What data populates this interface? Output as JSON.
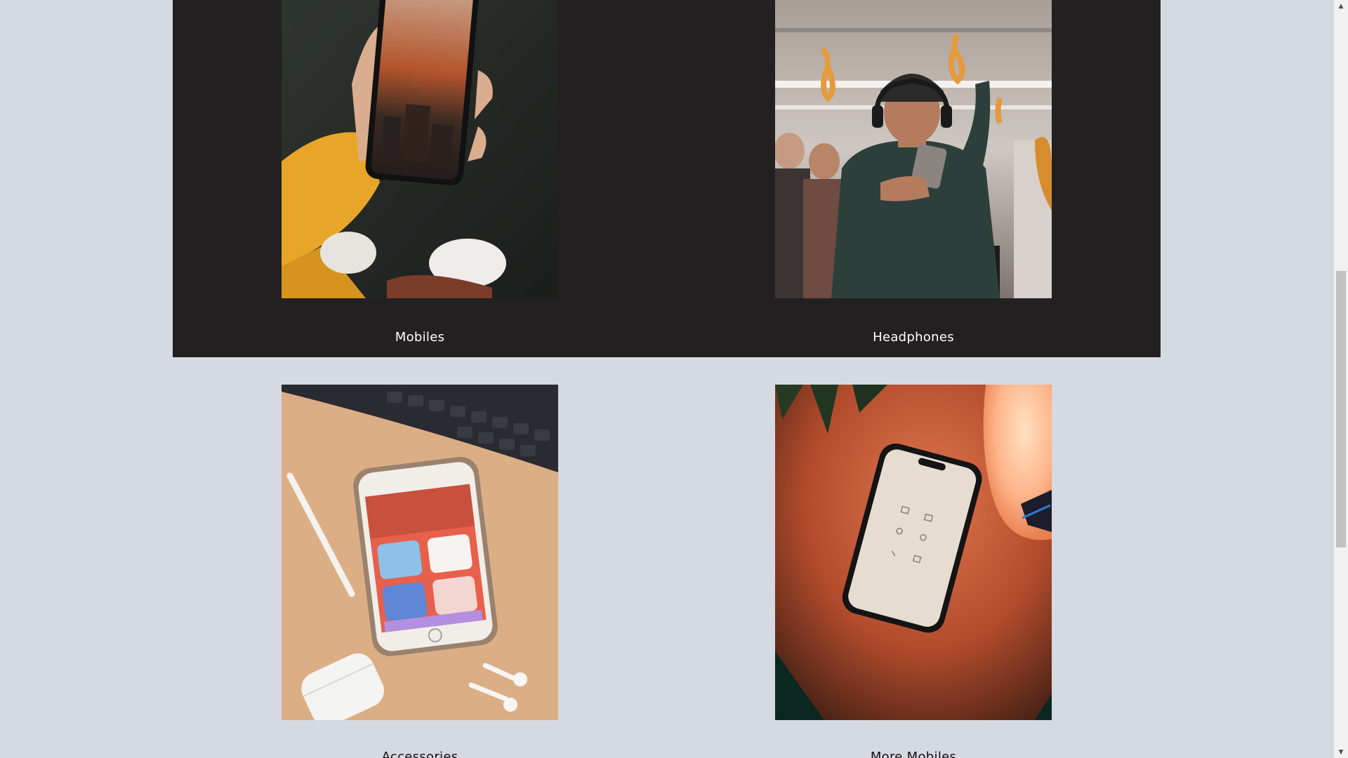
{
  "categories": [
    {
      "label": "Mobiles",
      "image": "hand-holding-phone-sunset-photo"
    },
    {
      "label": "Headphones",
      "image": "man-with-headphones-on-train-photo"
    },
    {
      "label": "Accessories",
      "image": "iphone-airpods-pencil-on-desk-photo"
    },
    {
      "label": "More Mobiles",
      "image": "phone-on-orange-table-photo"
    }
  ],
  "scrollbar": {
    "up_icon": "▲",
    "down_icon": "▼"
  },
  "colors": {
    "page_bg": "#d5d9e2",
    "dark_band": "#222021",
    "label_dark_text": "#ffffff",
    "label_light_text": "#111111"
  }
}
